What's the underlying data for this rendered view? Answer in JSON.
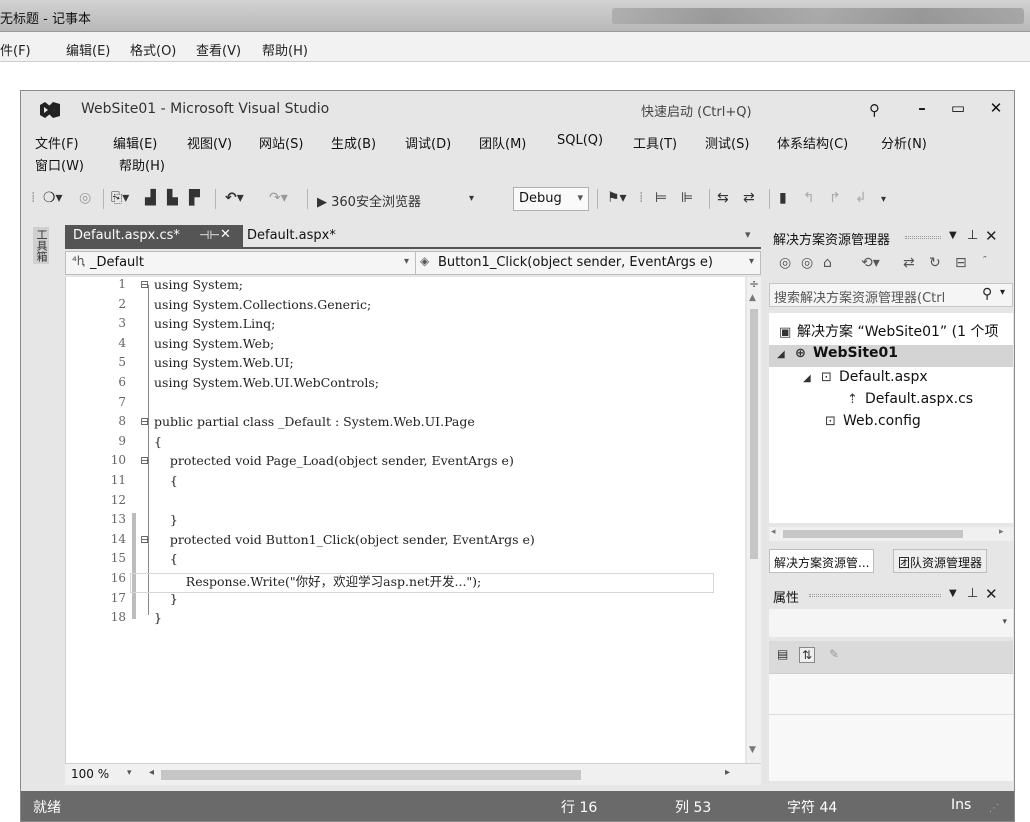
{
  "notepad": {
    "title": "无标题 - 记事本",
    "menu": [
      "件(F)",
      "编辑(E)",
      "格式(O)",
      "查看(V)",
      "帮助(H)"
    ]
  },
  "vs": {
    "title": "WebSite01 - Microsoft Visual Studio",
    "quick_launch": "快速启动 (Ctrl+Q)",
    "window_buttons": {
      "minimize": "–",
      "maximize": "▭",
      "close": "✕"
    },
    "menu_row1": [
      "文件(F)",
      "编辑(E)",
      "视图(V)",
      "网站(S)",
      "生成(B)",
      "调试(D)",
      "团队(M)",
      "SQL(Q)",
      "工具(T)",
      "测试(S)",
      "体系结构(C)",
      "分析(N)"
    ],
    "menu_row2": [
      "窗口(W)",
      "帮助(H)"
    ],
    "toolbar": {
      "browser": "▶ 360安全浏览器",
      "config": "Debug"
    },
    "left_rail": "工具箱",
    "tabs": [
      {
        "label": "Default.aspx.cs*",
        "pin": "⊣⊢",
        "close": "✕"
      },
      {
        "label": "Default.aspx*"
      }
    ],
    "nav": {
      "class_name": "_Default",
      "member_name": "Button1_Click(object sender, EventArgs e)"
    },
    "code": [
      {
        "n": "1",
        "fold": "⊟",
        "text": "using System;"
      },
      {
        "n": "2",
        "fold": "",
        "text": "using System.Collections.Generic;"
      },
      {
        "n": "3",
        "fold": "",
        "text": "using System.Linq;"
      },
      {
        "n": "4",
        "fold": "",
        "text": "using System.Web;"
      },
      {
        "n": "5",
        "fold": "",
        "text": "using System.Web.UI;"
      },
      {
        "n": "6",
        "fold": "",
        "text": "using System.Web.UI.WebControls;"
      },
      {
        "n": "7",
        "fold": "",
        "text": ""
      },
      {
        "n": "8",
        "fold": "⊟",
        "text": "public partial class _Default : System.Web.UI.Page"
      },
      {
        "n": "9",
        "fold": "",
        "text": "{"
      },
      {
        "n": "10",
        "fold": "⊟",
        "text": "    protected void Page_Load(object sender, EventArgs e)"
      },
      {
        "n": "11",
        "fold": "",
        "text": "    {"
      },
      {
        "n": "12",
        "fold": "",
        "text": ""
      },
      {
        "n": "13",
        "fold": "",
        "text": "    }"
      },
      {
        "n": "14",
        "fold": "⊟",
        "text": "    protected void Button1_Click(object sender, EventArgs e)"
      },
      {
        "n": "15",
        "fold": "",
        "text": "    {"
      },
      {
        "n": "16",
        "fold": "",
        "text": "        Response.Write(\"你好，欢迎学习asp.net开发...\");"
      },
      {
        "n": "17",
        "fold": "",
        "text": "    }"
      },
      {
        "n": "18",
        "fold": "",
        "text": "}"
      }
    ],
    "zoom": "100 %",
    "solution_explorer": {
      "title": "解决方案资源管理器",
      "search_placeholder": "搜索解决方案资源管理器(Ctrl",
      "tree": {
        "solution": "解决方案 “WebSite01” (1 个项",
        "project": "WebSite01",
        "page": "Default.aspx",
        "codebehind": "Default.aspx.cs",
        "config": "Web.config"
      },
      "bottom_tabs": [
        "解决方案资源管...",
        "团队资源管理器"
      ]
    },
    "properties": {
      "title": "属性"
    },
    "status": {
      "ready": "就绪",
      "line": "行 16",
      "col": "列 53",
      "ch": "字符 44",
      "mode": "Ins"
    }
  }
}
